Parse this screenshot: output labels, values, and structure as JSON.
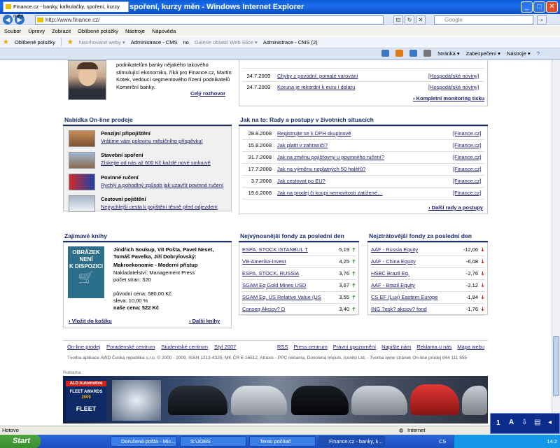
{
  "window": {
    "title": "Finance.cz - banky, kalkulačky, spoření, kurzy měn - Windows Internet Explorer"
  },
  "address": {
    "url": "http://www.finance.cz/",
    "search_placeholder": "Google"
  },
  "menu": [
    "Soubor",
    "Úpravy",
    "Zobrazit",
    "Oblíbené položky",
    "Nástroje",
    "Nápověda"
  ],
  "favbar": {
    "favorites": "Oblíbené položky",
    "suggested": "Navrhované weby ▾",
    "admin1": "Administrace - CMS",
    "no": "no",
    "gallery": "Galerie oblastí Web Slice ▾",
    "admin2": "Administrace - CMS (2)"
  },
  "tab": {
    "label": "Finance.cz - banky, kalkulačky, spoření, kurzy měn"
  },
  "commands": {
    "page": "Stránka ▾",
    "security": "Zabezpečení ▾",
    "tools": "Nástroje ▾"
  },
  "interview": {
    "text": "podnikatelům banky nějakého takového stimulující ekonomiku, říká pro Finance.cz, Martin Kotek, vedoucí segmentového řízení podnikatelů Komerční banky.",
    "link": "Celý rozhovor"
  },
  "monitoring": {
    "rows": [
      {
        "date": "24.7.2009",
        "title": "Chyby z povodní: pomalé varování",
        "src": "[Hospodářské noviny]"
      },
      {
        "date": "24.7.2009",
        "title": "Koruna je rekordní k euru i dolaru",
        "src": "[Hospodářské noviny]"
      }
    ],
    "more": "Kompletní monitoring tisku"
  },
  "online": {
    "title": "Nabídka On-line prodeje",
    "items": [
      {
        "title": "Penzijní připojištění",
        "desc": "Vrátíme vám polovinu měsíčního příspěvku!"
      },
      {
        "title": "Stavební spoření",
        "desc": "Získejte od nás až 600 Kč každé nové smlouvě"
      },
      {
        "title": "Povinné ručení",
        "desc": "Rychlý a pohodlný způsob jak uzavřít povinné ručení"
      },
      {
        "title": "Cestovní pojištění",
        "desc": "Nejrychlejší cesta k pojištění těsně před odjezdem"
      }
    ]
  },
  "advice": {
    "title": "Jak na to: Rady a postupy v životních situacích",
    "rows": [
      {
        "date": "28.8.2008",
        "title": "Registrujte se k DPH skupinově",
        "src": "[Finance.cz]"
      },
      {
        "date": "15.8.2008",
        "title": "Jak platit v zahraničí?",
        "src": "[Finance.cz]"
      },
      {
        "date": "31.7.2008",
        "title": "Jak na změnu pojišťovny u povinného ručení?",
        "src": "[Finance.cz]"
      },
      {
        "date": "17.7.2008",
        "title": "Jak na výměnu neplatných 50 haléřů?",
        "src": "[Finance.cz]"
      },
      {
        "date": "3.7.2008",
        "title": "Jak cestovat po EU?",
        "src": "[Finance.cz]"
      },
      {
        "date": "19.6.2008",
        "title": "Jak na prodej či koupi nemovitosti zatížené…",
        "src": "[Finance.cz]"
      }
    ],
    "more": "Další rady a postupy"
  },
  "books": {
    "title": "Zajímavé knihy",
    "cover": [
      "OBRÁZEK",
      "NENÍ",
      "K DISPOZICI"
    ],
    "authors": "Jindřich Soukup, Vít Pošta, Pavel Neset, Tomáš Pavelka, Jiří Dobrylovský:",
    "name": "Makroekonomie - Moderní přístup",
    "publisher": "Nakladatelství: Management Press",
    "pages": "počet stran: 520",
    "orig": "původní cena: 580,00 Kč",
    "discount": "sleva: 10,00 %",
    "price": "naše cena: 522 Kč",
    "cart": "Vložit do košíku",
    "more": "Další knihy"
  },
  "gainers": {
    "title": "Nejvýnosnější fondy za poslední den",
    "rows": [
      {
        "name": "ESPA. STOCK ISTANBUL T",
        "val": "5,19"
      },
      {
        "name": "VB-Amerika-Invest",
        "val": "4,25"
      },
      {
        "name": "ESPA. STOCK. RUSSIA",
        "val": "3,76"
      },
      {
        "name": "SGAM Eq Gold Mines USD",
        "val": "3,67"
      },
      {
        "name": "SGAM Eq. US Relative Value (US",
        "val": "3,55"
      },
      {
        "name": "Conseq Akciov? D",
        "val": "3,40"
      }
    ]
  },
  "losers": {
    "title": "Nejztrátovější fondy za poslední den",
    "rows": [
      {
        "name": "AAF - Russia Equity",
        "val": "-12,06"
      },
      {
        "name": "AAF - China Equity",
        "val": "-6,08"
      },
      {
        "name": "HSBC Brazil Eq.",
        "val": "-2,76"
      },
      {
        "name": "AAF - Brazil Equity",
        "val": "-2,12"
      },
      {
        "name": "CS EF (Lux) Eastern Europe",
        "val": "-1,84"
      },
      {
        "name": "ING ?esk? akciov? fond",
        "val": "-1,76"
      }
    ]
  },
  "footer": {
    "links1": [
      "On-line prodej",
      "Poradenské centrum",
      "Studentské centrum",
      "Styl 2007"
    ],
    "links2": [
      "RSS",
      "Press centrum",
      "Právní upozornění",
      "Napište nám",
      "Reklama u nás",
      "Mapa webu"
    ],
    "copy": "Tvorba aplikace AWD Česká republika s.r.o. © 2000 - 2009, ISSN 1213-4325, MK ČR E 16512, Atraxis - PPC reklama, Dovolená Impuls, Iconito Ltd. - Tvorba www stránek     On-line prodej  844 111 555",
    "reklama": "Reklama"
  },
  "banner": {
    "brand": "ALD Automotive",
    "award": "FLEET AWARDS",
    "year": "2009",
    "word": "FLEET"
  },
  "status": {
    "left": "Hotovo",
    "zone": "Internet"
  },
  "taskbar": {
    "start": "Start",
    "items": [
      "Doručená pošta - Mic...",
      "S:\\JOBS",
      "Tento počítač",
      "Finance.cz - banky, k..."
    ],
    "lang": "CS",
    "time": "14:2"
  },
  "colors": {
    "heading": "#1a2e6a",
    "up": "#2aa02a",
    "down": "#c02020"
  }
}
